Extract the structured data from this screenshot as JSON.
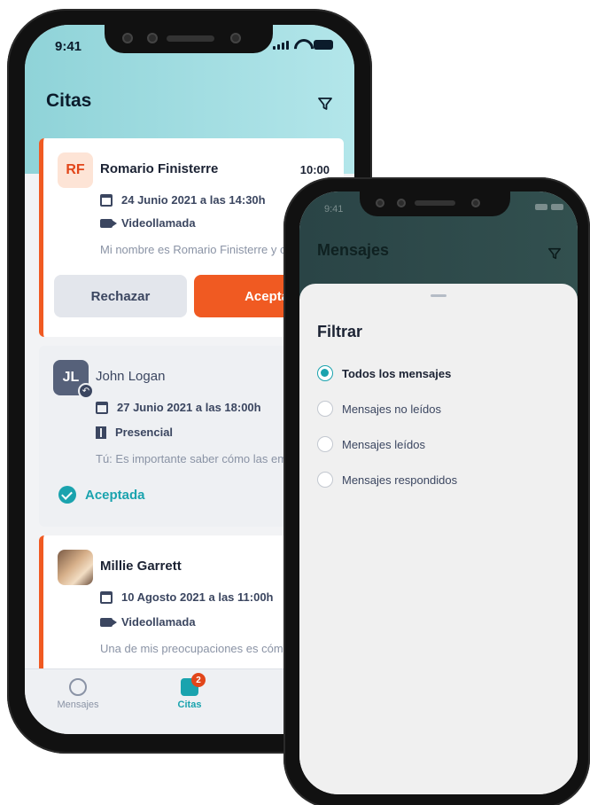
{
  "phone1": {
    "status": {
      "time": "9:41"
    },
    "title": "Citas",
    "cards": [
      {
        "initials": "RF",
        "name": "Romario Finisterre",
        "time": "10:00",
        "date": "24 Junio 2021 a las 14:30h",
        "mode": "Videollamada",
        "snippet": "Mi nombre es Romario Finisterre y c",
        "reject_label": "Rechazar",
        "accept_label": "Aceptar"
      },
      {
        "initials": "JL",
        "name": "John Logan",
        "date": "27 Junio 2021 a las 18:00h",
        "mode": "Presencial",
        "snippet": "Tú: Es importante saber cómo las em",
        "status_label": "Aceptada"
      },
      {
        "name": "Millie Garrett",
        "date": "10 Agosto 2021 a las 11:00h",
        "mode": "Videollamada",
        "snippet": "Una de mis preocupaciones es cómo"
      }
    ],
    "tabs": [
      {
        "label": "Mensajes"
      },
      {
        "label": "Citas",
        "badge": "2"
      }
    ]
  },
  "phone2": {
    "status": {
      "time": "9:41"
    },
    "title": "Mensajes",
    "sheet_title": "Filtrar",
    "options": [
      {
        "label": "Todos los mensajes",
        "selected": true
      },
      {
        "label": "Mensajes no leídos",
        "selected": false
      },
      {
        "label": "Mensajes leídos",
        "selected": false
      },
      {
        "label": "Mensajes respondidos",
        "selected": false
      }
    ]
  },
  "colors": {
    "accent_orange": "#f05a22",
    "accent_teal": "#1aa3ae",
    "header_teal": "#8fd3d8",
    "header_dark": "#2a4446"
  }
}
